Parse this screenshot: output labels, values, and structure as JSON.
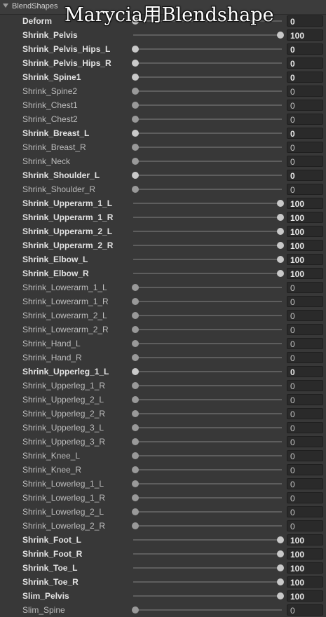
{
  "header": {
    "label": "BlendShapes"
  },
  "overlay_title": "Marycia用Blendshape",
  "rows": [
    {
      "name": "Deform",
      "value": "0",
      "level": 0,
      "bold": true
    },
    {
      "name": "Shrink_Pelvis",
      "value": "100",
      "level": 1,
      "bold": true
    },
    {
      "name": "Shrink_Pelvis_Hips_L",
      "value": "0",
      "level": 0,
      "bold": true
    },
    {
      "name": "Shrink_Pelvis_Hips_R",
      "value": "0",
      "level": 0,
      "bold": true
    },
    {
      "name": "Shrink_Spine1",
      "value": "0",
      "level": 0,
      "bold": true
    },
    {
      "name": "Shrink_Spine2",
      "value": "0",
      "level": 0,
      "bold": false
    },
    {
      "name": "Shrink_Chest1",
      "value": "0",
      "level": 0,
      "bold": false
    },
    {
      "name": "Shrink_Chest2",
      "value": "0",
      "level": 0,
      "bold": false
    },
    {
      "name": "Shrink_Breast_L",
      "value": "0",
      "level": 0,
      "bold": true
    },
    {
      "name": "Shrink_Breast_R",
      "value": "0",
      "level": 0,
      "bold": false
    },
    {
      "name": "Shrink_Neck",
      "value": "0",
      "level": 0,
      "bold": false
    },
    {
      "name": "Shrink_Shoulder_L",
      "value": "0",
      "level": 0,
      "bold": true
    },
    {
      "name": "Shrink_Shoulder_R",
      "value": "0",
      "level": 0,
      "bold": false
    },
    {
      "name": "Shrink_Upperarm_1_L",
      "value": "100",
      "level": 1,
      "bold": true
    },
    {
      "name": "Shrink_Upperarm_1_R",
      "value": "100",
      "level": 1,
      "bold": true
    },
    {
      "name": "Shrink_Upperarm_2_L",
      "value": "100",
      "level": 1,
      "bold": true
    },
    {
      "name": "Shrink_Upperarm_2_R",
      "value": "100",
      "level": 1,
      "bold": true
    },
    {
      "name": "Shrink_Elbow_L",
      "value": "100",
      "level": 1,
      "bold": true
    },
    {
      "name": "Shrink_Elbow_R",
      "value": "100",
      "level": 1,
      "bold": true
    },
    {
      "name": "Shrink_Lowerarm_1_L",
      "value": "0",
      "level": 0,
      "bold": false
    },
    {
      "name": "Shrink_Lowerarm_1_R",
      "value": "0",
      "level": 0,
      "bold": false
    },
    {
      "name": "Shrink_Lowerarm_2_L",
      "value": "0",
      "level": 0,
      "bold": false
    },
    {
      "name": "Shrink_Lowerarm_2_R",
      "value": "0",
      "level": 0,
      "bold": false
    },
    {
      "name": "Shrink_Hand_L",
      "value": "0",
      "level": 0,
      "bold": false
    },
    {
      "name": "Shrink_Hand_R",
      "value": "0",
      "level": 0,
      "bold": false
    },
    {
      "name": "Shrink_Upperleg_1_L",
      "value": "0",
      "level": 0,
      "bold": true
    },
    {
      "name": "Shrink_Upperleg_1_R",
      "value": "0",
      "level": 0,
      "bold": false
    },
    {
      "name": "Shrink_Upperleg_2_L",
      "value": "0",
      "level": 0,
      "bold": false
    },
    {
      "name": "Shrink_Upperleg_2_R",
      "value": "0",
      "level": 0,
      "bold": false
    },
    {
      "name": "Shrink_Upperleg_3_L",
      "value": "0",
      "level": 0,
      "bold": false
    },
    {
      "name": "Shrink_Upperleg_3_R",
      "value": "0",
      "level": 0,
      "bold": false
    },
    {
      "name": "Shrink_Knee_L",
      "value": "0",
      "level": 0,
      "bold": false
    },
    {
      "name": "Shrink_Knee_R",
      "value": "0",
      "level": 0,
      "bold": false
    },
    {
      "name": "Shrink_Lowerleg_1_L",
      "value": "0",
      "level": 0,
      "bold": false
    },
    {
      "name": "Shrink_Lowerleg_1_R",
      "value": "0",
      "level": 0,
      "bold": false
    },
    {
      "name": "Shrink_Lowerleg_2_L",
      "value": "0",
      "level": 0,
      "bold": false
    },
    {
      "name": "Shrink_Lowerleg_2_R",
      "value": "0",
      "level": 0,
      "bold": false
    },
    {
      "name": "Shrink_Foot_L",
      "value": "100",
      "level": 1,
      "bold": true
    },
    {
      "name": "Shrink_Foot_R",
      "value": "100",
      "level": 1,
      "bold": true
    },
    {
      "name": "Shrink_Toe_L",
      "value": "100",
      "level": 1,
      "bold": true
    },
    {
      "name": "Shrink_Toe_R",
      "value": "100",
      "level": 1,
      "bold": true
    },
    {
      "name": "Slim_Pelvis",
      "value": "100",
      "level": 1,
      "bold": true
    },
    {
      "name": "Slim_Spine",
      "value": "0",
      "level": 0,
      "bold": false
    }
  ]
}
